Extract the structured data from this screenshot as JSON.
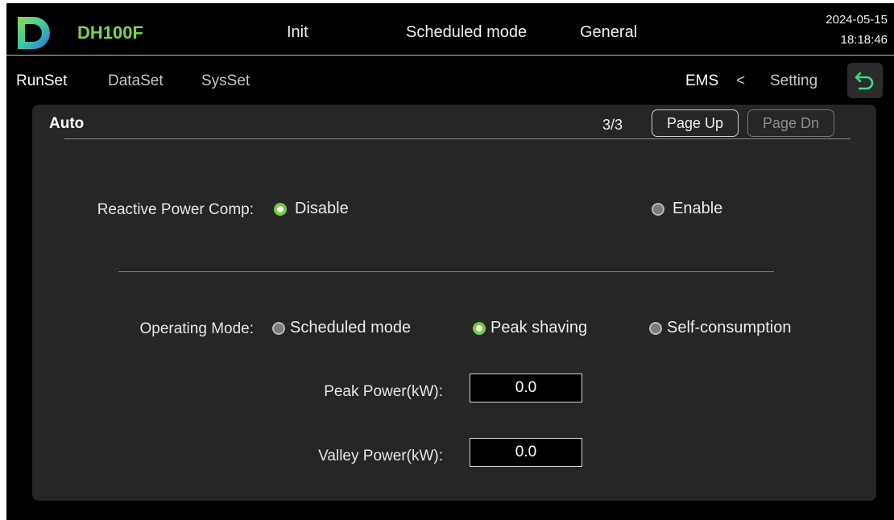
{
  "header": {
    "model": "DH100F",
    "nav": [
      "Init",
      "Scheduled mode",
      "General"
    ],
    "date": "2024-05-15",
    "time": "18:18:46",
    "logo_colors": [
      "#2f6fe0",
      "#3ec9a0",
      "#8fd94a"
    ]
  },
  "subnav": {
    "tabs": [
      "RunSet",
      "DataSet",
      "SysSet"
    ],
    "breadcrumb": {
      "current": "EMS",
      "separator": "<",
      "parent": "Setting"
    },
    "back_icon": "return-arrow-icon",
    "back_icon_color": "#3ddc84"
  },
  "panel": {
    "title": "Auto",
    "page_indicator": "3/3",
    "page_up": "Page Up",
    "page_dn": "Page Dn"
  },
  "reactive_power": {
    "label": "Reactive Power Comp:",
    "options": [
      {
        "label": "Disable",
        "selected": true
      },
      {
        "label": "Enable",
        "selected": false
      }
    ]
  },
  "operating_mode": {
    "label": "Operating Mode:",
    "options": [
      {
        "label": "Scheduled mode",
        "selected": false
      },
      {
        "label": "Peak shaving",
        "selected": true
      },
      {
        "label": "Self-consumption",
        "selected": false
      }
    ]
  },
  "peak_power": {
    "label": "Peak Power(kW):",
    "value": "0.0"
  },
  "valley_power": {
    "label": "Valley Power(kW):",
    "value": "0.0"
  },
  "colors": {
    "accent": "#6fcf3f",
    "model_text": "#7ed34a",
    "panel_bg": "#262626"
  }
}
